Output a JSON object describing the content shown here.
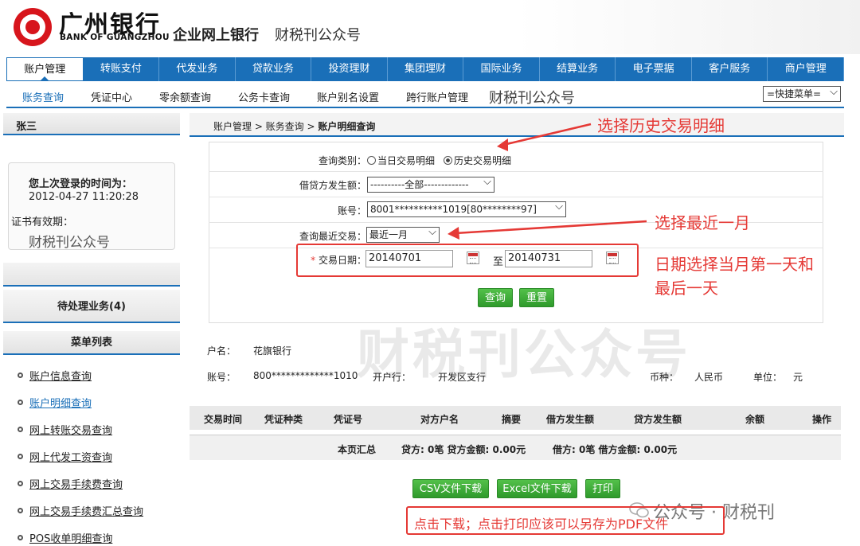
{
  "brand": {
    "logo_cn": "广州银行",
    "logo_en": "BANK OF GUANGZHOU",
    "title": "企业网上银行",
    "subtitle": "财税刊公众号"
  },
  "main_nav": [
    "账户管理",
    "转账支付",
    "代发业务",
    "贷款业务",
    "投资理财",
    "集团理财",
    "国际业务",
    "结算业务",
    "电子票据",
    "客户服务",
    "商户管理"
  ],
  "sub_nav": {
    "items": [
      "账务查询",
      "凭证中心",
      "零余额查询",
      "公务卡查询",
      "账户别名设置",
      "跨行账户管理"
    ],
    "watermark": "财税刊公众号",
    "quick_menu": "=快捷菜单="
  },
  "sidebar": {
    "user": "张三",
    "last_login_label": "您上次登录的时间为：",
    "last_login_time": "2012-04-27 11:20:28",
    "cert_label": "证书有效期：",
    "watermark": "财税刊公众号",
    "pending": "待处理业务(4)",
    "menu_header": "菜单列表",
    "menu": [
      "账户信息查询",
      "账户明细查询",
      "网上转账交易查询",
      "网上代发工资查询",
      "网上交易手续费查询",
      "网上交易手续费汇总查询",
      "POS收单明细查询"
    ]
  },
  "breadcrumb": {
    "prefix": "账户管理 > 账务查询 > ",
    "current": "账户明细查询"
  },
  "form": {
    "query_type_label": "查询类别：",
    "option_today": "当日交易明细",
    "option_history": "历史交易明细",
    "amount_label": "借贷方发生额：",
    "amount_value": "----------全部-------------",
    "account_label": "账号：",
    "account_value": "8001**********1019[80********97]",
    "recent_label": "查询最近交易：",
    "recent_value": "最近一月",
    "date_star": "*",
    "date_label": "交易日期：",
    "date_from": "20140701",
    "date_to_label": "至",
    "date_to": "20140731",
    "query_button": "查询",
    "reset_button": "重置"
  },
  "account_info": {
    "name_label": "户名：",
    "name_value": "花旗银行",
    "account_label": "账号：",
    "account_value": "800*************1010",
    "bank_label": "开户行：",
    "bank_value": "开发区支行",
    "currency_label": "币种：",
    "currency_value": "人民币",
    "unit_label": "单位：",
    "unit_value": "元"
  },
  "table": {
    "headers": [
      "交易时间",
      "凭证种类",
      "凭证号",
      "对方户名",
      "摘要",
      "借方发生额",
      "贷方发生额",
      "余额",
      "操作"
    ],
    "summary_label": "本页汇总",
    "summary_credit": "贷方: 0笔  贷方金额: 0.00元",
    "summary_debit": "借方: 0笔  借方金额: 0.00元"
  },
  "actions": {
    "csv": "CSV文件下载",
    "excel": "Excel文件下载",
    "print": "打印"
  },
  "annotations": {
    "history": "选择历史交易明细",
    "recent": "选择最近一月",
    "date_line1": "日期选择当月第一天和",
    "date_line2": "最后一天",
    "download": "点击下载；点击打印应该可以另存为PDF文件"
  },
  "watermarks": {
    "center": "财税刊公众号",
    "wechat": "公众号 · 财税刊"
  },
  "colors": {
    "nav_blue": "#1a6fb8",
    "annotation_red": "#e53935",
    "button_green": "#3aa836"
  }
}
